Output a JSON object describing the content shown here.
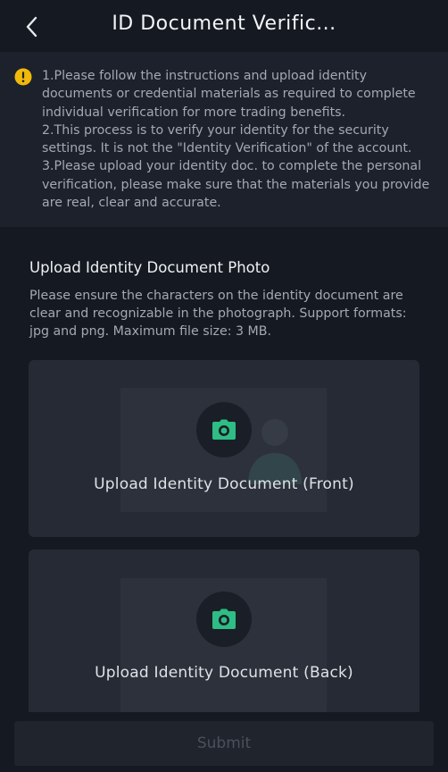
{
  "header": {
    "title": "ID Document Verific...",
    "back_icon": "chevron-left-icon"
  },
  "notice": {
    "icon": "info-icon",
    "icon_color": "#f0b90b",
    "lines": [
      "1.Please follow the instructions and upload identity",
      "documents or credential materials as required to complete",
      "individual verification for more trading benefits.",
      "2.This process is to verify your identity for the security",
      "settings. It is not the \"Identity Verification\" of the account.",
      "3.Please upload your identity doc. to complete the personal",
      "verification, please make sure that the materials you provide",
      "are real, clear and accurate."
    ]
  },
  "upload_section": {
    "title": "Upload Identity Document Photo",
    "description_lines": [
      "Please ensure the characters on the identity document are",
      "clear and recognizable in the photograph. Support formats:",
      "jpg and png. Maximum file size: 3 MB."
    ],
    "cards": [
      {
        "label": "Upload Identity Document (Front)",
        "icon": "camera-icon"
      },
      {
        "label": "Upload Identity Document (Back)",
        "icon": "camera-icon"
      }
    ]
  },
  "submit": {
    "label": "Submit",
    "disabled": true
  },
  "colors": {
    "background": "#151a22",
    "accent": "#2ebd85",
    "warning": "#f0b90b",
    "card": "#252a34"
  }
}
